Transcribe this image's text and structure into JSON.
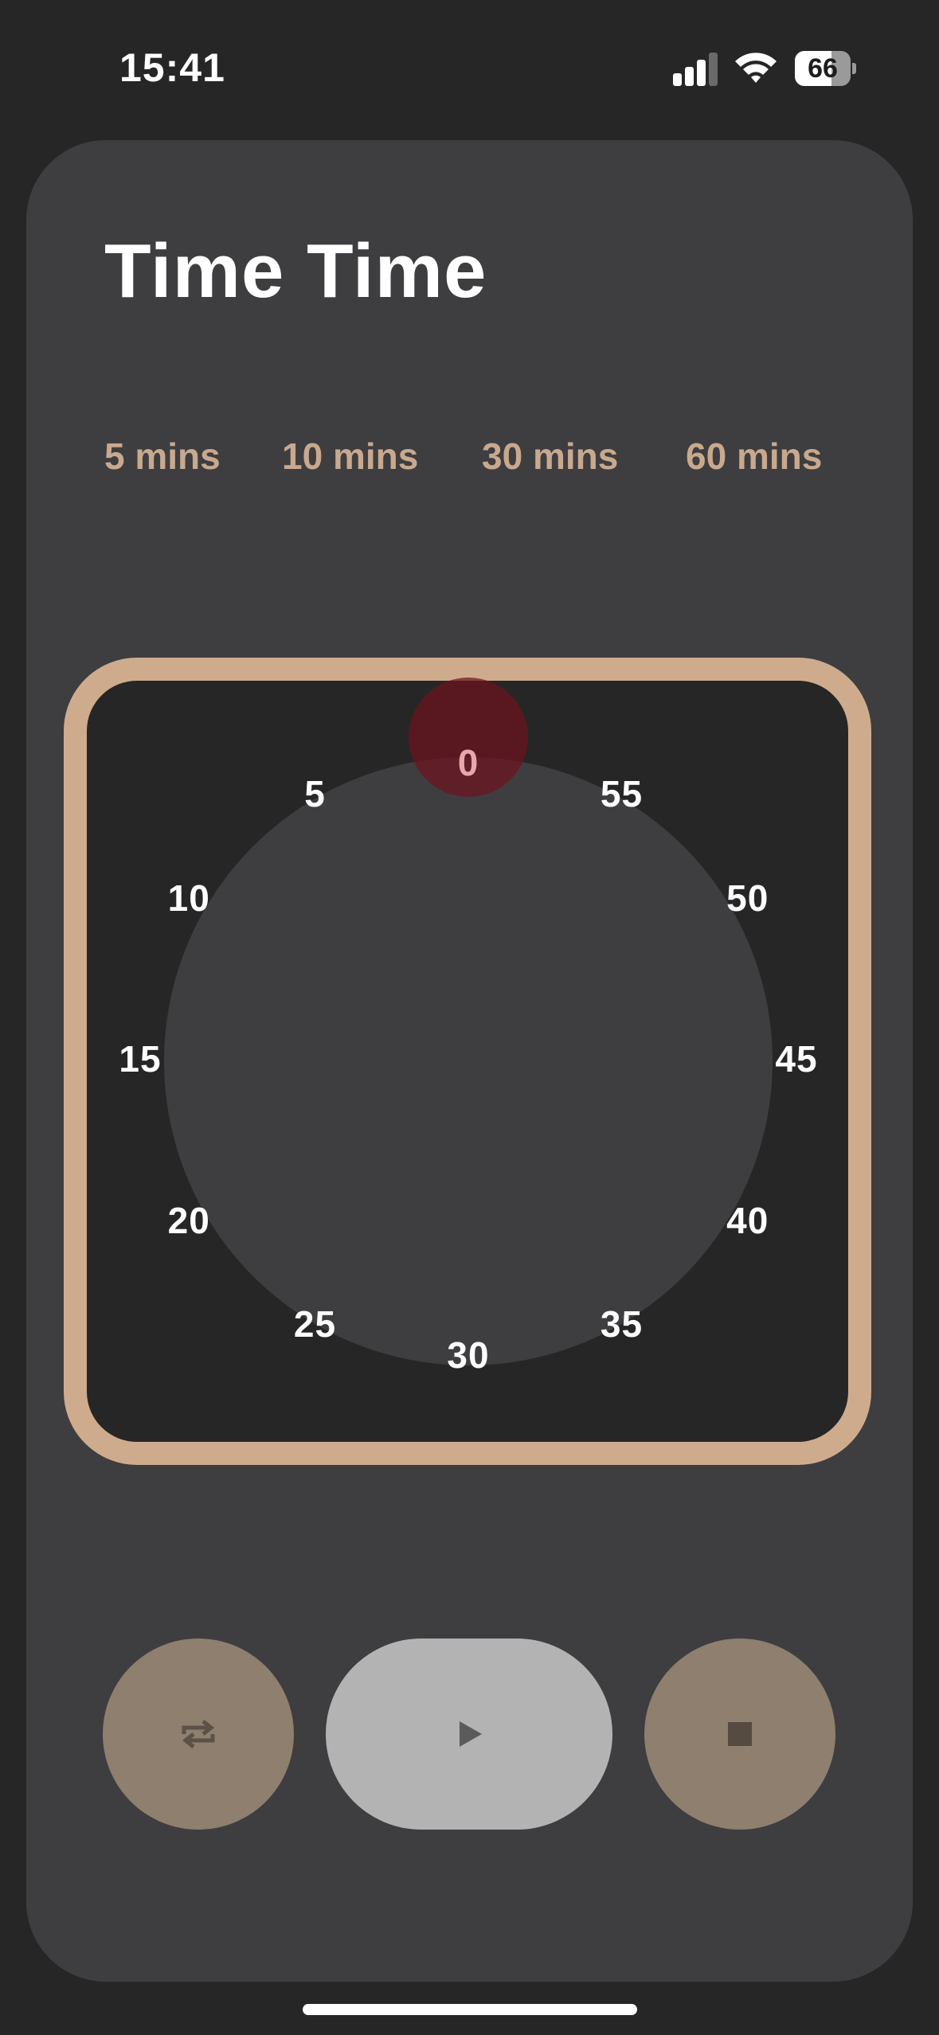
{
  "status_bar": {
    "time": "15:41",
    "battery_percent": "66",
    "battery_level": 0.66,
    "signal_bars": 4,
    "signal_bars_active": 3
  },
  "app": {
    "title": "Time Time"
  },
  "presets": [
    {
      "label": "5 mins"
    },
    {
      "label": "10 mins"
    },
    {
      "label": "30 mins"
    },
    {
      "label": "60 mins"
    }
  ],
  "dial": {
    "selected_minutes": 0,
    "labels": [
      "0",
      "5",
      "10",
      "15",
      "20",
      "25",
      "30",
      "35",
      "40",
      "45",
      "50",
      "55"
    ]
  },
  "controls": {
    "loop_icon": "repeat-icon",
    "play_icon": "play-icon",
    "stop_icon": "stop-icon"
  },
  "colors": {
    "background": "#262626",
    "card": "#3e3e41",
    "accent": "#cfab8e",
    "preset_text": "#c9a98e",
    "secondary_button": "#8e7f6e",
    "primary_button": "#b3b3b3",
    "knob": "#6e141e",
    "active_label": "#e7a7ad"
  }
}
